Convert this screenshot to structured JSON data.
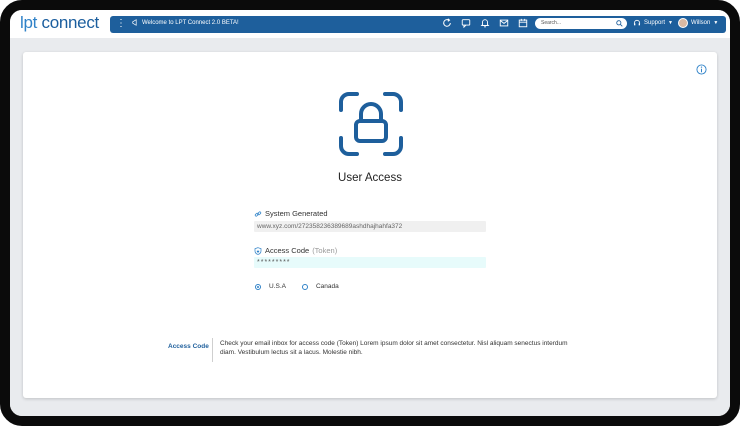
{
  "app": {
    "logo_prefix": "lpt",
    "logo_suffix": "connect"
  },
  "topbar": {
    "welcome": "Welcome to LPT Connect 2.0 BETA!",
    "search_placeholder": "Search...",
    "support_label": "Support",
    "user_name": "Willson"
  },
  "page": {
    "title": "User Access",
    "system_label": "System Generated",
    "system_value": "www.xyz.com/272358236389689ashdhajhahfa372",
    "code_label": "Access Code",
    "code_label_sub": "(Token)",
    "code_value": "*********",
    "radio_options": [
      {
        "label": "U.S.A",
        "selected": true
      },
      {
        "label": "Canada",
        "selected": false
      }
    ],
    "note_label": "Access Code",
    "note_text": "Check your email inbox for access code (Token) Lorem ipsum dolor sit amet consectetur. Nisl aliquam senectus interdum diam. Vestibulum lectus sit a lacus. Molestie nibh."
  },
  "colors": {
    "brand": "#1e5f9c",
    "accent": "#2f82c8"
  },
  "icons": [
    "menu-icon",
    "megaphone-icon",
    "refresh-icon",
    "chat-icon",
    "bell-icon",
    "mail-icon",
    "calendar-icon",
    "search-icon",
    "headset-icon",
    "chevron-down-icon",
    "info-icon",
    "lock-icon",
    "link-icon",
    "shield-icon"
  ]
}
